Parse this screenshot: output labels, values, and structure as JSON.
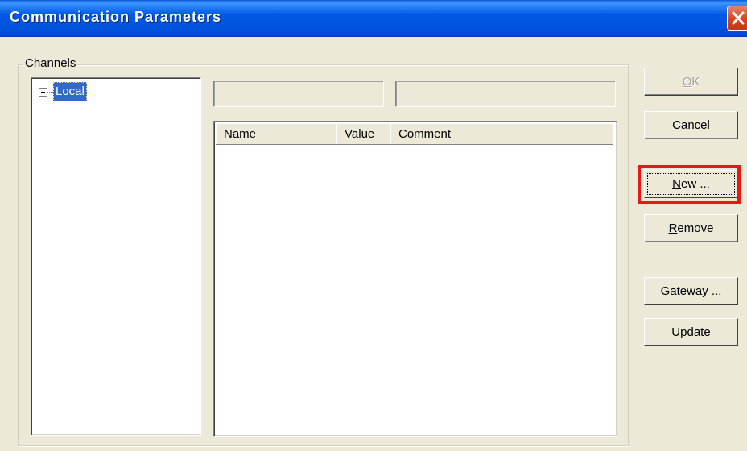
{
  "window": {
    "title": "Communication Parameters"
  },
  "channels": {
    "legend": "Channels",
    "tree": [
      {
        "label": "Local",
        "expanded": true,
        "selected": true
      }
    ]
  },
  "list": {
    "columns": [
      "Name",
      "Value",
      "Comment"
    ],
    "rows": []
  },
  "buttons": {
    "ok": {
      "label": "OK",
      "accel": "O",
      "rest": "K",
      "enabled": false
    },
    "cancel": {
      "label": "Cancel",
      "accel": "C",
      "rest": "ancel"
    },
    "new": {
      "label": "New ...",
      "accel": "N",
      "rest": "ew ...",
      "highlighted": true
    },
    "remove": {
      "label": "Remove",
      "accel": "R",
      "rest": "emove"
    },
    "gateway": {
      "label": "Gateway ...",
      "accel": "G",
      "rest": "ateway ..."
    },
    "update": {
      "label": "Update",
      "accel": "U",
      "rest": "pdate"
    }
  },
  "colors": {
    "titlebar": "#0058e6",
    "highlight": "#e81818",
    "selection": "#316ac5"
  }
}
